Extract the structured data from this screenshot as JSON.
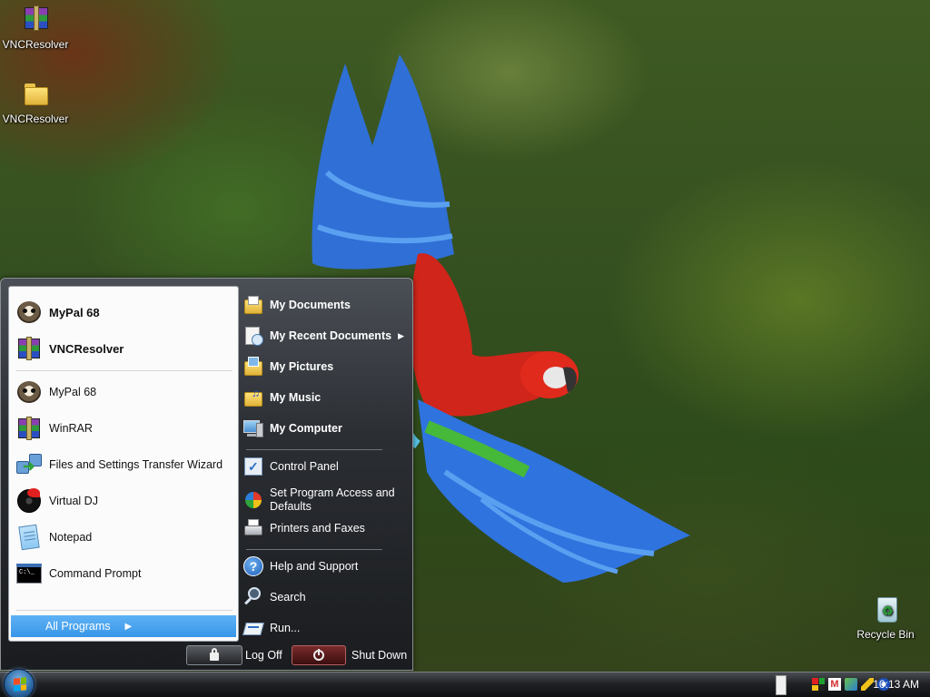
{
  "desktop": {
    "icons": [
      {
        "label": "VNCResolver",
        "icon": "winrar-archive-icon"
      },
      {
        "label": "VNCResolver",
        "icon": "folder-icon"
      },
      {
        "label": "Recycle Bin",
        "icon": "recycle-bin-icon"
      }
    ]
  },
  "start_menu": {
    "pinned": [
      {
        "label": "MyPal 68",
        "icon": "mypal-raccoon-icon"
      },
      {
        "label": "VNCResolver",
        "icon": "winrar-archive-icon"
      }
    ],
    "recent": [
      {
        "label": "MyPal 68",
        "icon": "mypal-raccoon-icon"
      },
      {
        "label": "WinRAR",
        "icon": "winrar-icon"
      },
      {
        "label": "Files and Settings Transfer Wizard",
        "icon": "transfer-wizard-icon"
      },
      {
        "label": "Virtual DJ",
        "icon": "virtual-dj-icon"
      },
      {
        "label": "Notepad",
        "icon": "notepad-icon"
      },
      {
        "label": "Command Prompt",
        "icon": "command-prompt-icon"
      }
    ],
    "all_programs": "All Programs",
    "places": [
      {
        "label": "My Documents",
        "icon": "documents-folder-icon"
      },
      {
        "label": "My Recent Documents",
        "icon": "recent-documents-icon"
      },
      {
        "label": "My Pictures",
        "icon": "pictures-folder-icon"
      },
      {
        "label": "My Music",
        "icon": "music-folder-icon"
      },
      {
        "label": "My Computer",
        "icon": "computer-icon"
      }
    ],
    "settings": [
      {
        "label": "Control Panel",
        "icon": "control-panel-icon"
      },
      {
        "label": "Set Program Access and Defaults",
        "icon": "program-defaults-icon"
      },
      {
        "label": "Printers and Faxes",
        "icon": "printer-icon"
      }
    ],
    "help": [
      {
        "label": "Help and Support",
        "icon": "help-icon"
      },
      {
        "label": "Search",
        "icon": "search-icon"
      },
      {
        "label": "Run...",
        "icon": "run-icon"
      }
    ],
    "log_off": "Log Off",
    "shut_down": "Shut Down"
  },
  "taskbar": {
    "clock": "10:13 AM",
    "tray_icons": [
      "keyboard-icon",
      "color-grid-icon",
      "gmail-icon",
      "network-icon",
      "pencil-icon",
      "eye-icon"
    ]
  },
  "colors": {
    "menu_dark": "#1f2124",
    "menu_light_pane": "#fbfbfb",
    "highlight": "#3896e8",
    "taskbar": "#151618"
  }
}
